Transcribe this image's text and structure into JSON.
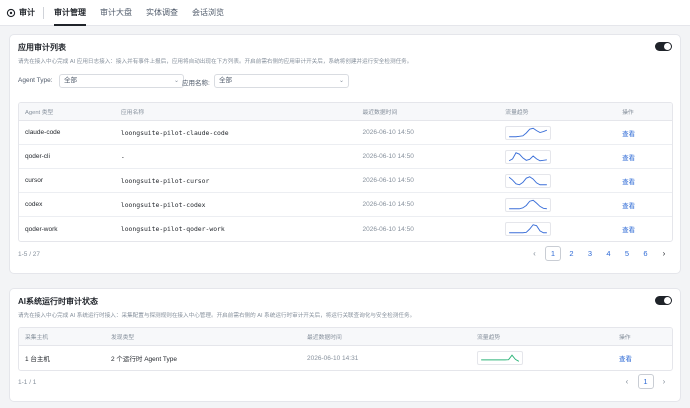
{
  "header": {
    "brand_label": "审计",
    "brand_icon": "shield-gear-icon",
    "tabs": [
      {
        "label": "审计管理",
        "active": true
      },
      {
        "label": "审计大盘",
        "active": false
      },
      {
        "label": "实体调查",
        "active": false
      },
      {
        "label": "会话浏览",
        "active": false
      }
    ]
  },
  "app_audit": {
    "title": "应用审计列表",
    "description": "请先在接入中心完成 AI 应用日志接入：接入并有事件上报后，应用将自动出现在下方列表。开启前需右侧的应用审计开关后，系统将创建并运行安全检测任务。",
    "toggle_on": true,
    "filters": {
      "agent_type_label": "Agent Type:",
      "agent_type_value": "全部",
      "app_name_label": "应用名称:",
      "app_name_value": "全部"
    },
    "columns": [
      "Agent 类型",
      "应用名称",
      "最近数据时间",
      "流量趋势",
      "操作"
    ],
    "rows": [
      {
        "agent": "claude-code",
        "app": "loongsuite-pilot-claude-code",
        "time": "2026-06-10 14:50",
        "action": "查看",
        "trend": [
          0.1,
          0.1,
          0.1,
          0.15,
          0.2,
          0.5,
          0.9,
          1.0,
          0.75,
          0.55,
          0.65,
          0.8
        ]
      },
      {
        "agent": "qoder-cli",
        "app": "-",
        "time": "2026-06-10 14:50",
        "action": "查看",
        "trend": [
          0.1,
          0.3,
          0.95,
          0.8,
          0.4,
          0.15,
          0.25,
          0.6,
          0.3,
          0.1,
          0.15,
          0.2
        ]
      },
      {
        "agent": "cursor",
        "app": "loongsuite-pilot-cursor",
        "time": "2026-06-10 14:50",
        "action": "查看",
        "trend": [
          0.9,
          0.6,
          0.2,
          0.1,
          0.35,
          0.8,
          0.95,
          0.7,
          0.3,
          0.1,
          0.1,
          0.1
        ]
      },
      {
        "agent": "codex",
        "app": "loongsuite-pilot-codex",
        "time": "2026-06-10 14:50",
        "action": "查看",
        "trend": [
          0.1,
          0.1,
          0.1,
          0.1,
          0.2,
          0.45,
          0.9,
          1.0,
          0.7,
          0.35,
          0.15,
          0.1
        ]
      },
      {
        "agent": "qoder-work",
        "app": "loongsuite-pilot-qoder-work",
        "time": "2026-06-10 14:50",
        "action": "查看",
        "trend": [
          0.1,
          0.1,
          0.1,
          0.1,
          0.1,
          0.15,
          0.5,
          0.95,
          0.85,
          0.3,
          0.1,
          0.1
        ]
      }
    ],
    "total_text": "1-5 / 27",
    "pages": [
      "1",
      "2",
      "3",
      "4",
      "5",
      "6"
    ],
    "current_page": "1"
  },
  "runtime_audit": {
    "title": "AI系统运行时审计状态",
    "description": "请先在接入中心完成 AI 系统运行时接入：采集配置与探测规则在接入中心管理。开启前需右侧的 AI 系统运行时审计开关后，将运行关联查询化与安全检测任务。",
    "toggle_on": true,
    "columns": [
      "采集主机",
      "发现类型",
      "最近数据时间",
      "流量趋势",
      "操作"
    ],
    "rows": [
      {
        "host": "1 台主机",
        "type": "2 个运行时 Agent Type",
        "time": "2026-06-10 14:31",
        "action": "查看",
        "trend": [
          0.3,
          0.3,
          0.3,
          0.3,
          0.3,
          0.3,
          0.3,
          0.3,
          0.32,
          0.8,
          0.35,
          0.15
        ]
      }
    ],
    "total_text": "1-1 / 1",
    "pages": [
      "1"
    ],
    "current_page": "1"
  },
  "colors": {
    "accent_link": "#2e6ad6",
    "sparkline_blue": "#3b6fd8",
    "sparkline_green": "#2fb57a",
    "toggle_on": "#1f2329"
  }
}
